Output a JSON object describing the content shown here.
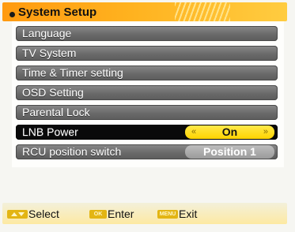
{
  "header": {
    "title": "System Setup"
  },
  "menu": {
    "items": [
      {
        "label": "Language",
        "value": ""
      },
      {
        "label": "TV System",
        "value": ""
      },
      {
        "label": "Time & Timer setting",
        "value": ""
      },
      {
        "label": "OSD Setting",
        "value": ""
      },
      {
        "label": "Parental Lock",
        "value": ""
      },
      {
        "label": "LNB Power",
        "value": "On",
        "selected": true
      },
      {
        "label": "RCU position switch",
        "value": "Position 1"
      }
    ]
  },
  "footer": {
    "select_label": "Select",
    "enter_label": "Enter",
    "exit_label": "Exit",
    "enter_key": "OK",
    "exit_key": "MENU"
  },
  "colors": {
    "accent": "#ffb21f",
    "selected_value": "#ffd400",
    "item": "#6a6a6a"
  }
}
